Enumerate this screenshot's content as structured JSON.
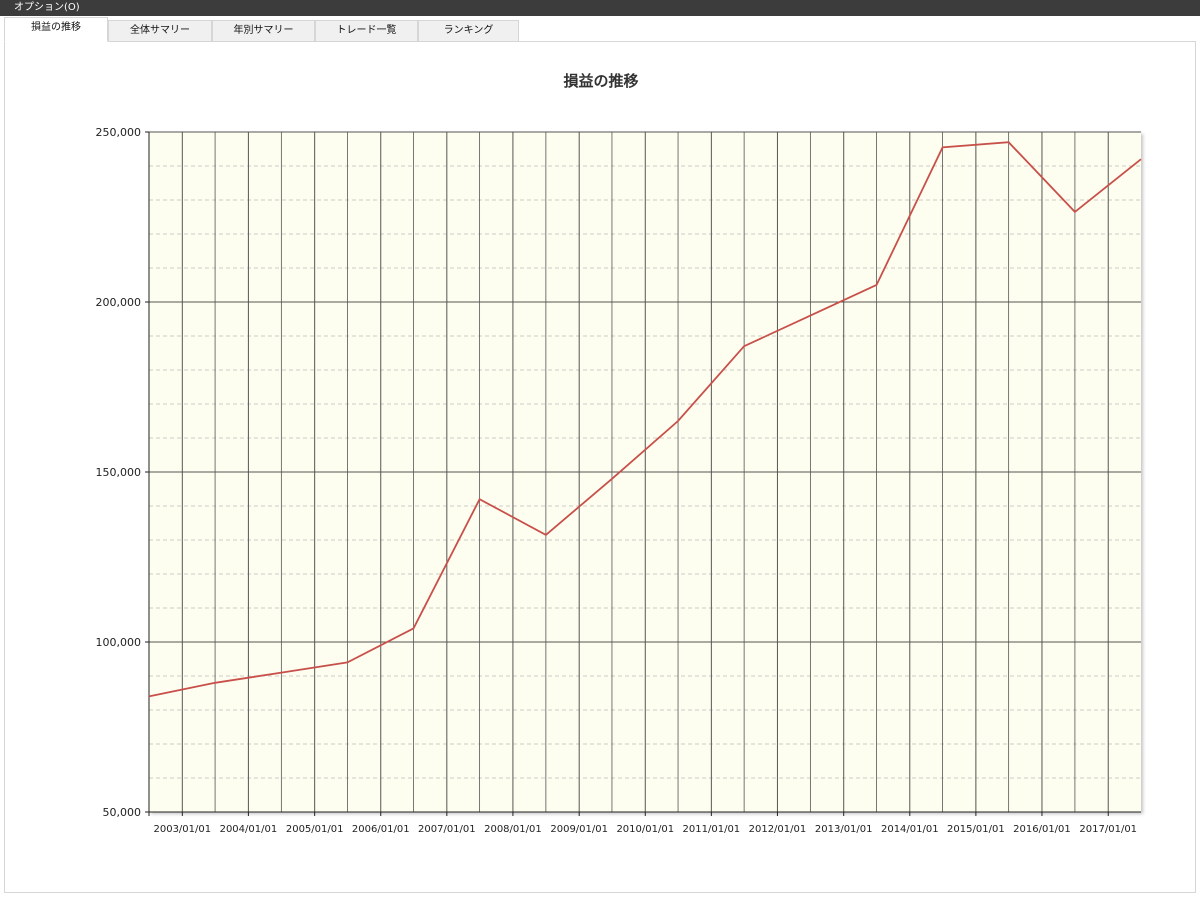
{
  "menubar": {
    "options_label": "オプション(O)"
  },
  "tabs": [
    {
      "label": "損益の推移",
      "active": true
    },
    {
      "label": "全体サマリー",
      "active": false
    },
    {
      "label": "年別サマリー",
      "active": false
    },
    {
      "label": "トレード一覧",
      "active": false
    },
    {
      "label": "ランキング",
      "active": false
    }
  ],
  "colors": {
    "plot_background": "#fefef0",
    "series_line": "#c8504a",
    "major_grid": "#555555",
    "minor_grid": "#bcbcbc"
  },
  "chart_data": {
    "type": "line",
    "title": "損益の推移",
    "xlabel": "",
    "ylabel": "",
    "ylim": [
      50000,
      250000
    ],
    "xlim": [
      "2002-07-01",
      "2017-07-01"
    ],
    "y_ticks": [
      50000,
      100000,
      150000,
      200000,
      250000
    ],
    "y_tick_labels": [
      "50,000",
      "100,000",
      "150,000",
      "200,000",
      "250,000"
    ],
    "x_ticks": [
      "2003-01-01",
      "2004-01-01",
      "2005-01-01",
      "2006-01-01",
      "2007-01-01",
      "2008-01-01",
      "2009-01-01",
      "2010-01-01",
      "2011-01-01",
      "2012-01-01",
      "2013-01-01",
      "2014-01-01",
      "2015-01-01",
      "2016-01-01",
      "2017-01-01"
    ],
    "x_tick_labels": [
      "2003/01/01",
      "2004/01/01",
      "2005/01/01",
      "2006/01/01",
      "2007/01/01",
      "2008/01/01",
      "2009/01/01",
      "2010/01/01",
      "2011/01/01",
      "2012/01/01",
      "2013/01/01",
      "2014/01/01",
      "2015/01/01",
      "2016/01/01",
      "2017/01/01"
    ],
    "grid": true,
    "legend": "none",
    "series": [
      {
        "x": [
          "2002-07-01",
          "2003-07-01",
          "2004-07-01",
          "2005-07-01",
          "2006-07-01",
          "2007-07-01",
          "2008-07-01",
          "2009-07-01",
          "2010-07-01",
          "2011-07-01",
          "2012-07-01",
          "2013-07-01",
          "2014-07-01",
          "2015-07-01",
          "2016-07-01",
          "2017-07-01"
        ],
        "y": [
          84000,
          88000,
          91000,
          94000,
          104000,
          142000,
          131500,
          148000,
          165000,
          187000,
          196000,
          205000,
          245500,
          247000,
          226500,
          242000
        ]
      }
    ]
  }
}
